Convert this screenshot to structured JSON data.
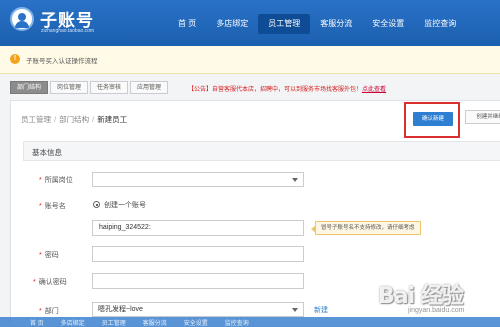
{
  "header": {
    "title": "子账号",
    "subtitle": "zizhanghao.taobao.com",
    "nav": [
      {
        "label": "首 页",
        "active": false
      },
      {
        "label": "多店绑定",
        "active": false
      },
      {
        "label": "员工管理",
        "active": true
      },
      {
        "label": "客服分流",
        "active": false
      },
      {
        "label": "安全设置",
        "active": false
      },
      {
        "label": "监控查询",
        "active": false
      }
    ]
  },
  "notice": {
    "icon": "info-icon",
    "text": "子账号买入认证操作流程"
  },
  "tabs": [
    {
      "label": "部门结构",
      "active": true
    },
    {
      "label": "岗位管理",
      "active": false
    },
    {
      "label": "任务审核",
      "active": false
    },
    {
      "label": "应用管理",
      "active": false
    }
  ],
  "announcement": {
    "text": "【公告】自营客服代本店，招聘中，可以到服务市场找客服外包！",
    "link": "点此查看"
  },
  "breadcrumb": {
    "items": [
      "员工管理",
      "部门结构"
    ],
    "current": "新建员工"
  },
  "actions": {
    "confirm": "确认新建",
    "continue": "创建并继续"
  },
  "form": {
    "section_title": "基本信息",
    "dept_label": "所属岗位",
    "dept_value": "",
    "account_label": "账号名",
    "account_option": "创建一个账号",
    "account_value": "haiping_324522:",
    "account_tip": "冒号子账号名不支持修改，请仔细考虑",
    "password_label": "密码",
    "confirm_password_label": "确认密码",
    "department_label": "部门",
    "department_value": "嗯孔发程~love",
    "new_link": "新建"
  },
  "bottom_nav": [
    "首 页",
    "多店绑定",
    "员工管理",
    "客服分流",
    "安全设置",
    "监控查询"
  ],
  "watermark": {
    "text": "Bai 经验",
    "sub": "jingyan.baidu.com"
  },
  "colors": {
    "header": "#1b5fae",
    "primary_button": "#2e7fd2",
    "highlight_box": "#d9302f",
    "required": "#d62020"
  }
}
